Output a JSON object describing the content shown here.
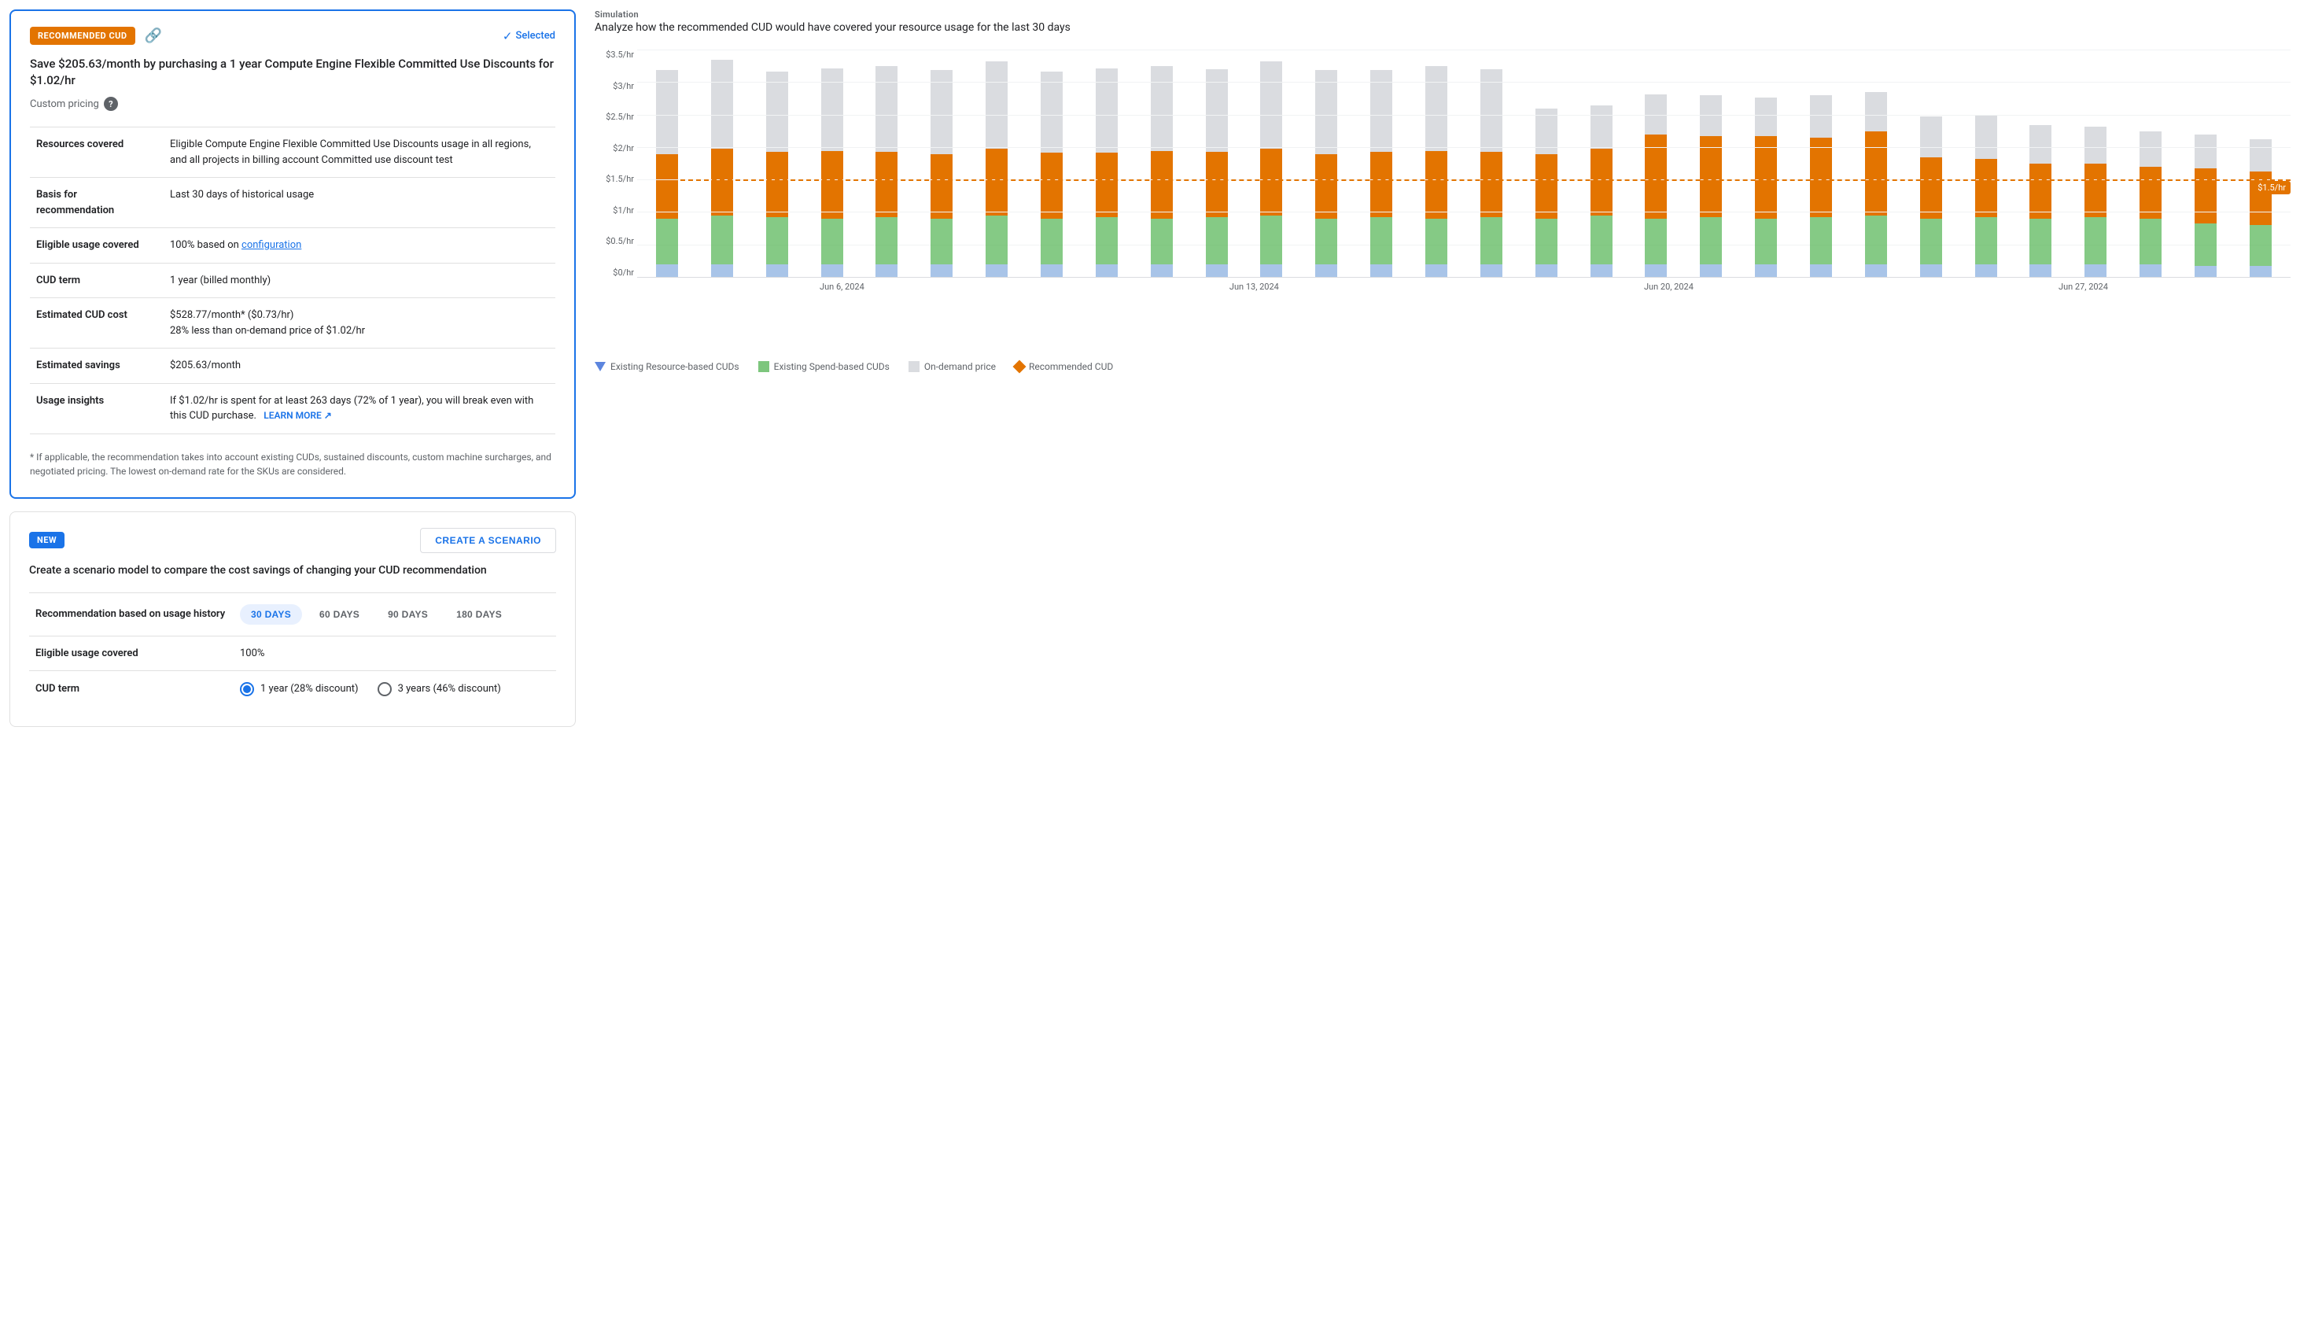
{
  "recommendedCard": {
    "badge": "RECOMMENDED CUD",
    "selectedLabel": "Selected",
    "title": "Save $205.63/month by purchasing a 1 year Compute Engine Flexible Committed Use Discounts for $1.02/hr",
    "customPricingLabel": "Custom pricing",
    "details": [
      {
        "label": "Resources covered",
        "value": "Eligible Compute Engine Flexible Committed Use Discounts usage in all regions, and all projects in billing account Committed use discount test"
      },
      {
        "label": "Basis for recommendation",
        "value": "Last 30 days of historical usage"
      },
      {
        "label": "Eligible usage covered",
        "value": "100% based on",
        "linkText": "configuration"
      },
      {
        "label": "CUD term",
        "value": "1 year (billed monthly)"
      },
      {
        "label": "Estimated CUD cost",
        "value": "$528.77/month* ($0.73/hr)",
        "subValue": "28% less than on-demand price of $1.02/hr"
      },
      {
        "label": "Estimated savings",
        "value": "$205.63/month"
      },
      {
        "label": "Usage insights",
        "value": "If $1.02/hr is spent for at least 263 days (72% of 1 year), you will break even with this CUD purchase.",
        "learnMore": "LEARN MORE"
      }
    ],
    "footnote": "* If applicable, the recommendation takes into account existing CUDs, sustained discounts, custom machine surcharges, and negotiated pricing. The lowest on-demand rate for the SKUs are considered."
  },
  "scenarioCard": {
    "badge": "NEW",
    "createButtonLabel": "CREATE A SCENARIO",
    "title": "Create a scenario model to compare the cost savings of changing your CUD recommendation",
    "rows": [
      {
        "label": "Recommendation based on usage history",
        "type": "chips",
        "chips": [
          {
            "label": "30 DAYS",
            "active": true
          },
          {
            "label": "60 DAYS",
            "active": false
          },
          {
            "label": "90 DAYS",
            "active": false
          },
          {
            "label": "180 DAYS",
            "active": false
          }
        ]
      },
      {
        "label": "Eligible usage covered",
        "type": "text",
        "value": "100%"
      },
      {
        "label": "CUD term",
        "type": "radio",
        "options": [
          {
            "label": "1 year (28% discount)",
            "selected": true
          },
          {
            "label": "3 years (46% discount)",
            "selected": false
          }
        ]
      }
    ]
  },
  "simulation": {
    "sectionLabel": "Simulation",
    "subtitle": "Analyze how the recommended CUD would have covered your resource usage for the last 30 days",
    "yLabels": [
      "$3.5/hr",
      "$3/hr",
      "$2.5/hr",
      "$2/hr",
      "$1.5/hr",
      "$1/hr",
      "$0.5/hr",
      "$0/hr"
    ],
    "xLabels": [
      "Jun 6, 2024",
      "Jun 13, 2024",
      "Jun 20, 2024",
      "Jun 27, 2024"
    ],
    "dashedLineLabel": "$1.5/hr",
    "legend": [
      {
        "type": "triangle",
        "label": "Existing Resource-based CUDs"
      },
      {
        "type": "square-green",
        "label": "Existing Spend-based CUDs"
      },
      {
        "type": "square-gray",
        "label": "On-demand price"
      },
      {
        "type": "diamond",
        "label": "Recommended CUD"
      }
    ],
    "bars": [
      {
        "gray": 55,
        "orange": 42,
        "green": 30,
        "blue": 8
      },
      {
        "gray": 58,
        "orange": 44,
        "green": 32,
        "blue": 8
      },
      {
        "gray": 52,
        "orange": 43,
        "green": 31,
        "blue": 8
      },
      {
        "gray": 54,
        "orange": 44,
        "green": 30,
        "blue": 8
      },
      {
        "gray": 56,
        "orange": 43,
        "green": 31,
        "blue": 8
      },
      {
        "gray": 55,
        "orange": 42,
        "green": 30,
        "blue": 8
      },
      {
        "gray": 57,
        "orange": 44,
        "green": 32,
        "blue": 8
      },
      {
        "gray": 53,
        "orange": 43,
        "green": 30,
        "blue": 8
      },
      {
        "gray": 55,
        "orange": 42,
        "green": 31,
        "blue": 8
      },
      {
        "gray": 56,
        "orange": 44,
        "green": 30,
        "blue": 8
      },
      {
        "gray": 54,
        "orange": 43,
        "green": 31,
        "blue": 8
      },
      {
        "gray": 57,
        "orange": 44,
        "green": 32,
        "blue": 8
      },
      {
        "gray": 55,
        "orange": 42,
        "green": 30,
        "blue": 8
      },
      {
        "gray": 53,
        "orange": 43,
        "green": 31,
        "blue": 8
      },
      {
        "gray": 56,
        "orange": 44,
        "green": 30,
        "blue": 8
      },
      {
        "gray": 54,
        "orange": 43,
        "green": 31,
        "blue": 8
      },
      {
        "gray": 30,
        "orange": 42,
        "green": 30,
        "blue": 8
      },
      {
        "gray": 28,
        "orange": 44,
        "green": 32,
        "blue": 8
      },
      {
        "gray": 26,
        "orange": 55,
        "green": 30,
        "blue": 8
      },
      {
        "gray": 27,
        "orange": 53,
        "green": 31,
        "blue": 8
      },
      {
        "gray": 25,
        "orange": 54,
        "green": 30,
        "blue": 8
      },
      {
        "gray": 28,
        "orange": 52,
        "green": 31,
        "blue": 8
      },
      {
        "gray": 26,
        "orange": 55,
        "green": 32,
        "blue": 8
      },
      {
        "gray": 27,
        "orange": 40,
        "green": 30,
        "blue": 8
      },
      {
        "gray": 29,
        "orange": 38,
        "green": 31,
        "blue": 8
      },
      {
        "gray": 25,
        "orange": 36,
        "green": 30,
        "blue": 8
      },
      {
        "gray": 24,
        "orange": 35,
        "green": 31,
        "blue": 8
      },
      {
        "gray": 23,
        "orange": 34,
        "green": 30,
        "blue": 8
      },
      {
        "gray": 22,
        "orange": 36,
        "green": 28,
        "blue": 7
      },
      {
        "gray": 21,
        "orange": 35,
        "green": 27,
        "blue": 7
      }
    ]
  }
}
